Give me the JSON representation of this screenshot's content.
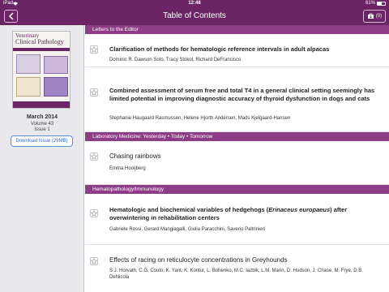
{
  "status_bar": {
    "carrier": "iPad",
    "time": "12:48",
    "battery_label": "61%",
    "battery_level": 0.61
  },
  "nav": {
    "title": "Table of Contents",
    "cart_count": "(0)"
  },
  "sidebar": {
    "cover_title_line1": "Veterinary",
    "cover_title_line2": "Clinical Pathology",
    "issue_date": "March 2014",
    "volume": "Volume 43",
    "issue": "Issue 1",
    "download_label": "Download Issue (29MB)"
  },
  "sections": [
    {
      "header": "Letters to the Editor",
      "articles": [
        {
          "title": "Clarification of methods for hematologic reference intervals in adult alpacas",
          "authors": "Dominic R. Dawson Soto, Tracy Stokol, Richard DeFrancisco"
        },
        {
          "title": "Combined assessment of serum free and total T4 in a general clinical setting seemingly has limited potential in improving diagnostic accuracy of thyroid dysfunction in dogs and cats",
          "authors": "Stephanie Haugaard Rasmussen, Helene Hjorth Andersen, Mads Kjelgaard-Hansen"
        }
      ]
    },
    {
      "header": "Laboratory Medicine: Yesterday • Today • Tomorrow",
      "articles": [
        {
          "title": "Chasing rainbows",
          "authors": "Emma Hooijberg"
        }
      ]
    },
    {
      "header": "Hematopathology/Immunology",
      "articles": [
        {
          "title_before": "Hematologic and biochemical variables of hedgehogs (",
          "title_italic": "Erinaceus europaeus",
          "title_after": ") after overwintering in rehabilitation centers",
          "authors": "Gabriele Rossi, Gerard Mangiagalli, Giulia Paracchini, Saverio Paltrinieri"
        },
        {
          "title": "Effects of racing on reticulocyte concentrations in Greyhounds",
          "authors": "S.J. Horvath, C.G. Couto, K. Yant, K. Kontur, L. Bohenko, M.C. Iazbik, L.M. Marin, D. Hudson, J. Chase, M. Frye, D.B. DeNicola"
        }
      ]
    }
  ]
}
